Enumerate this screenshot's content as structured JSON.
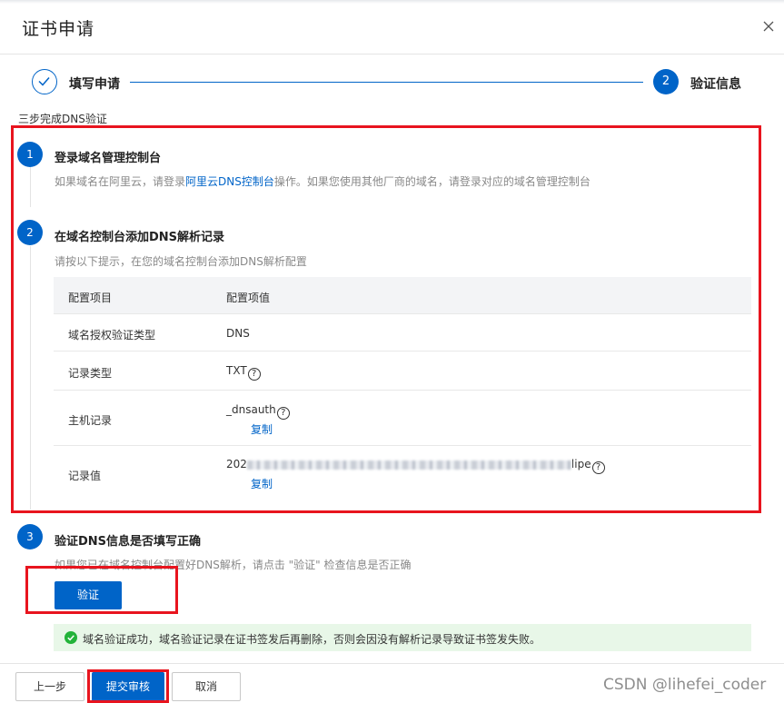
{
  "dialog": {
    "title": "证书申请"
  },
  "steps": {
    "step1_label": "填写申请",
    "step2_number": "2",
    "step2_label": "验证信息"
  },
  "subtitle": "三步完成DNS验证",
  "section1": {
    "number": "1",
    "title": "登录域名管理控制台",
    "desc_before": "如果域名在阿里云，请登录",
    "desc_link": "阿里云DNS控制台",
    "desc_after": "操作。如果您使用其他厂商的域名，请登录对应的域名管理控制台"
  },
  "section2": {
    "number": "2",
    "title": "在域名控制台添加DNS解析记录",
    "desc": "请按以下提示，在您的域名控制台添加DNS解析配置"
  },
  "table": {
    "header_key": "配置项目",
    "header_value": "配置项值",
    "rows": [
      {
        "key": "域名授权验证类型",
        "value": "DNS"
      },
      {
        "key": "记录类型",
        "value": "TXT"
      },
      {
        "key": "主机记录",
        "value": "_dnsauth",
        "copy": "复制"
      },
      {
        "key": "记录值",
        "value_prefix": "202",
        "value_suffix": "lipe",
        "copy": "复制"
      }
    ],
    "help_glyph": "?"
  },
  "section3": {
    "number": "3",
    "title": "验证DNS信息是否填写正确",
    "desc": "如果您已在域名控制台配置好DNS解析，请点击 \"验证\" 检查信息是否正确",
    "verify_button": "验证"
  },
  "success_message": "域名验证成功，域名验证记录在证书签发后再删除，否则会因没有解析记录导致证书签发失败。",
  "footer": {
    "prev_button": "上一步",
    "submit_button": "提交审核",
    "cancel_button": "取消"
  },
  "watermark": "CSDN @lihefei_coder",
  "colors": {
    "primary": "#0064c8",
    "highlight_box": "#e8141e",
    "success_bg": "#e8f7e8",
    "success_icon": "#23b33a"
  }
}
